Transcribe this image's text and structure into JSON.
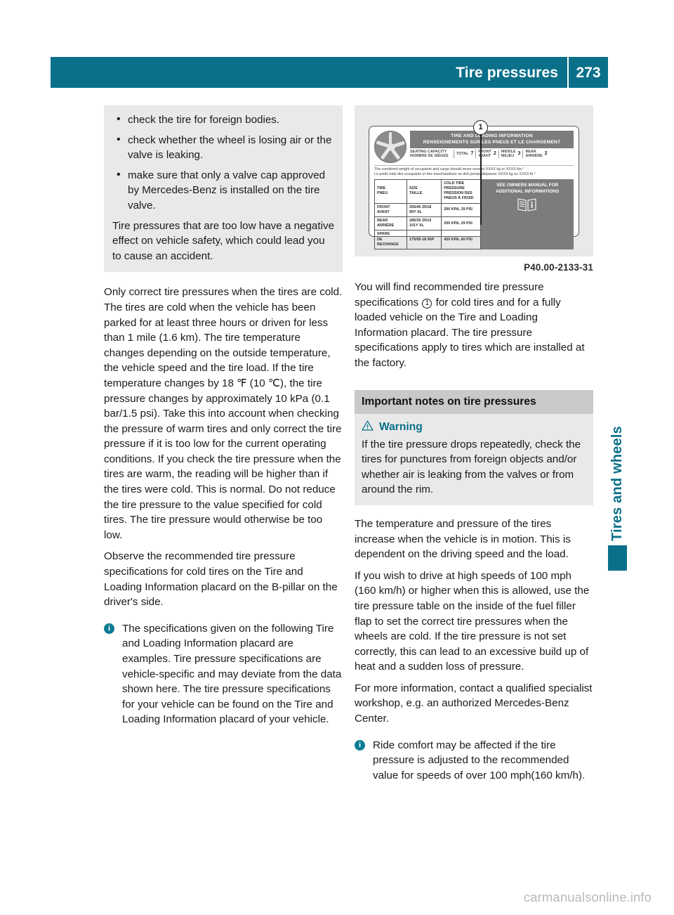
{
  "header": {
    "title": "Tire pressures",
    "page_number": "273"
  },
  "left_column": {
    "gray_box": {
      "bullets": [
        "check the tire for foreign bodies.",
        "check whether the wheel is losing air or the valve is leaking.",
        "make sure that only a valve cap approved by Mercedes-Benz is installed on the tire valve."
      ],
      "tail": "Tire pressures that are too low have a negative effect on vehicle safety, which could lead you to cause an accident."
    },
    "paragraphs": [
      "Only correct tire pressures when the tires are cold. The tires are cold when the vehicle has been parked for at least three hours or driven for less than 1 mile (1.6 km). The tire temperature changes depending on the outside temperature, the vehicle speed and the tire load. If the tire temperature changes by 18 ℉ (10 ℃), the tire pressure changes by approximately 10 kPa (0.1 bar/1.5 psi). Take this into account when checking the pressure of warm tires and only correct the tire pressure if it is too low for the current operating conditions. If you check the tire pressure when the tires are warm, the reading will be higher than if the tires were cold. This is normal. Do not reduce the tire pressure to the value specified for cold tires. The tire pressure would otherwise be too low.",
      "Observe the recommended tire pressure specifications for cold tires on the Tire and Loading Information placard on the B-pillar on the driver's side."
    ],
    "note": "The specifications given on the following Tire and Loading Information placard are examples. Tire pressure specifications are vehicle-specific and may deviate from the data shown here. The tire pressure specifications for your vehicle can be found on the Tire and Loading Information placard of your vehicle."
  },
  "figure": {
    "caption": "P40.00-2133-31",
    "callout": "1",
    "placard": {
      "title_en": "TIRE AND LOADING INFORMATION",
      "title_fr": "RENSEIGNEMENTS SUR LES PNEUS ET LE CHARGEMENT",
      "seating_label_en": "SEATING CAPACITY",
      "seating_label_fr": "NOMBRE DE SIÈGES",
      "seating_cells": [
        {
          "label": "TOTAL",
          "value": "7"
        },
        {
          "label_en": "FRONT",
          "label_fr": "AVANT",
          "value": "2"
        },
        {
          "label_en": "MIDDLE",
          "label_fr": "MILIEU",
          "value": "3"
        },
        {
          "label_en": "REAR",
          "label_fr": "ARRIÈRE",
          "value": "2"
        }
      ],
      "weight_en": "The combined weight of occupants and cargo should never exceed XXXX kg or XXXX lbs.°",
      "weight_fr": "Le poids total des occupants et des marchandises ne doit jamais dépasser XXXX kg ou XXXX lb.°",
      "table": {
        "headers": [
          {
            "en": "TIRE",
            "fr": "PNEU"
          },
          {
            "en": "SIZE",
            "fr": "TAILLE"
          },
          {
            "en": "COLD TIRE PRESSURE",
            "fr": "PRESSION DES PNEUS À FROID"
          }
        ],
        "rows": [
          {
            "label_en": "FRONT",
            "label_fr": "AVANT",
            "size": "255/40 ZR18 99Y XL",
            "pressure": "200 KPA, 29 PSI"
          },
          {
            "label_en": "REAR",
            "label_fr": "ARRIÈRE",
            "size": "285/35 ZR19 101Y XL",
            "pressure": "200 KPA, 29 PSI"
          },
          {
            "label_en": "SPARE",
            "label_fr": "DE RECHANGE",
            "size": "175/55-18 95P",
            "pressure": "420 KPA, 60 PSI"
          }
        ]
      },
      "see_owners": "SEE OWNERS MANUAL FOR ADDITIONAL INFORMATIONS"
    }
  },
  "right_column": {
    "intro_before": "You will find recommended tire pressure specifications ",
    "intro_callout": "1",
    "intro_after": " for cold tires and for a fully loaded vehicle on the Tire and Loading Information placard. The tire pressure specifications apply to tires which are installed at the factory.",
    "section_title": "Important notes on tire pressures",
    "warning": {
      "label": "Warning",
      "text": "If the tire pressure drops repeatedly, check the tires for punctures from foreign objects and/or whether air is leaking from the valves or from around the rim."
    },
    "paragraphs": [
      "The temperature and pressure of the tires increase when the vehicle is in motion. This is dependent on the driving speed and the load.",
      "If you wish to drive at high speeds of 100 mph (160 km/h) or higher when this is allowed, use the tire pressure table on the inside of the fuel filler flap to set the correct tire pressures when the wheels are cold. If the tire pressure is not set correctly, this can lead to an excessive build up of heat and a sudden loss of pressure.",
      "For more information, contact a qualified specialist workshop, e.g. an authorized Mercedes-Benz Center."
    ],
    "note": "Ride comfort may be affected if the tire pressure is adjusted to the recommended value for speeds of over 100 mph(160 km/h)."
  },
  "side_tab": {
    "label": "Tires and wheels"
  },
  "watermark": "carmanualsonline.info",
  "colors": {
    "accent_teal": "#0a708a",
    "box_gray": "#e9e9e9",
    "band_gray": "#c9c9c9",
    "text": "#1a1a1a",
    "watermark": "#b9b9b9"
  }
}
